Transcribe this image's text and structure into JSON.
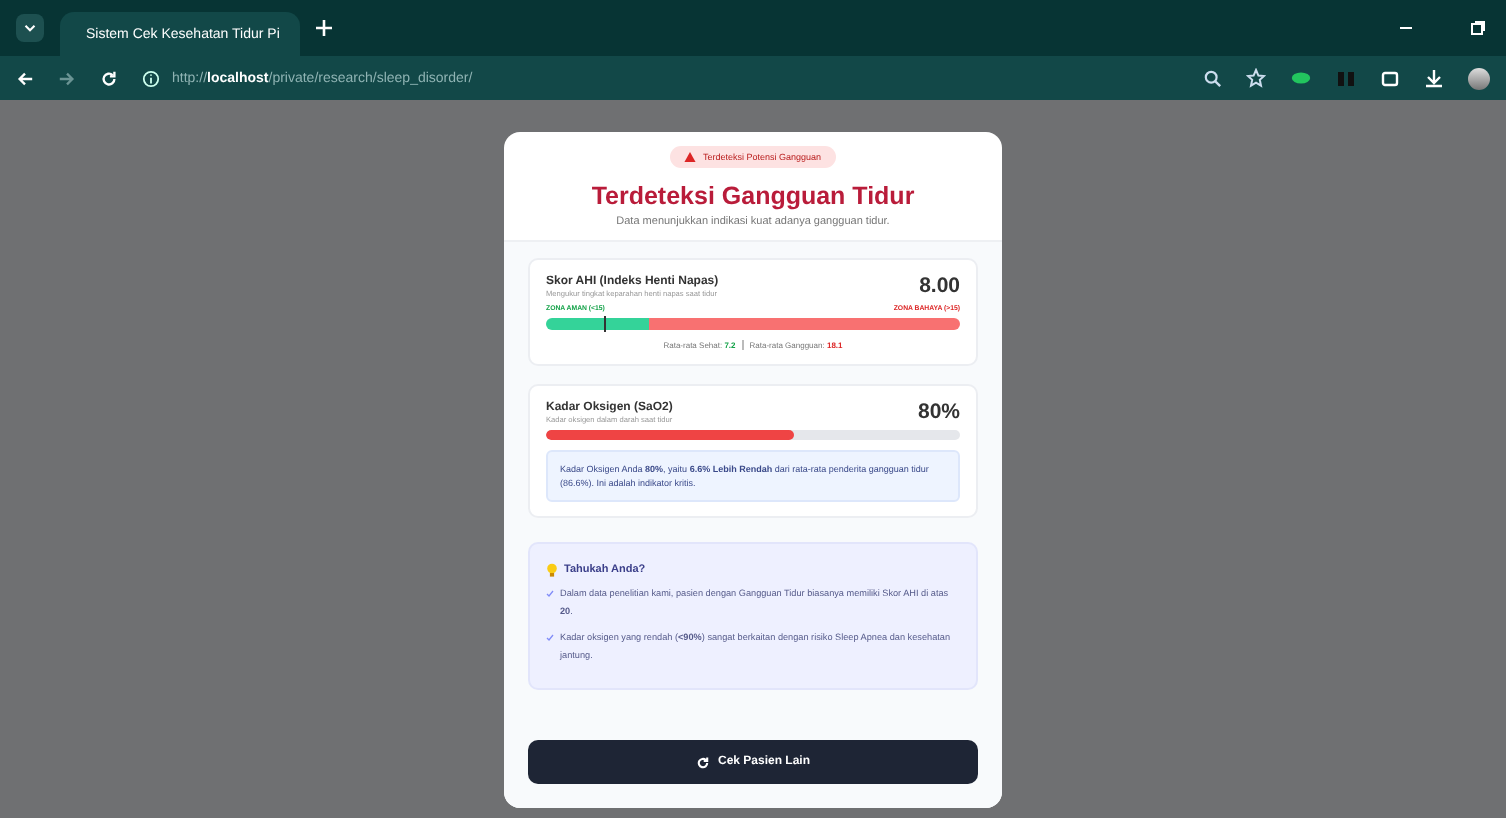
{
  "browser": {
    "tab_title": "Sistem Cek Kesehatan Tidur Pi",
    "url_prefix": "http://",
    "url_host": "localhost",
    "url_path": "/private/research/sleep_disorder/"
  },
  "badge": "Terdeteksi Potensi Gangguan",
  "title": "Terdeteksi Gangguan Tidur",
  "subtitle": "Data menunjukkan indikasi kuat adanya gangguan tidur.",
  "ahi": {
    "title": "Skor AHI (Indeks Henti Napas)",
    "description": "Mengukur tingkat keparahan henti napas saat tidur",
    "score": "8.00",
    "safe_label": "ZONA AMAN (<15)",
    "danger_label": "ZONA BAHAYA (>15)",
    "level": 0.14,
    "averages": [
      {
        "label": "Rata-rata Sehat:",
        "value": "7.2",
        "kind": "healthy"
      },
      {
        "label": "Rata-rata Gangguan:",
        "value": "18.1",
        "kind": "disorder"
      }
    ]
  },
  "oxygen": {
    "title": "Kadar Oksigen (SaO2)",
    "description": "Kadar oksigen dalam darah saat tidur",
    "value": "80%",
    "level": 0.6,
    "note": "Kadar Oksigen Anda **80%**, yaitu **6.6% Lebih Rendah** dari rata-rata penderita gangguan tidur (86.6%). Ini adalah indikator kritis."
  },
  "tips": {
    "title": "Tahukah Anda?",
    "items": [
      "Dalam data penelitian kami, pasien dengan Gangguan Tidur biasanya memiliki Skor AHI di atas **20**.",
      "Kadar oksigen yang rendah (**<90%**) sangat berkaitan dengan risiko Sleep Apnea dan kesehatan jantung."
    ]
  },
  "button": "Cek Pasien Lain"
}
